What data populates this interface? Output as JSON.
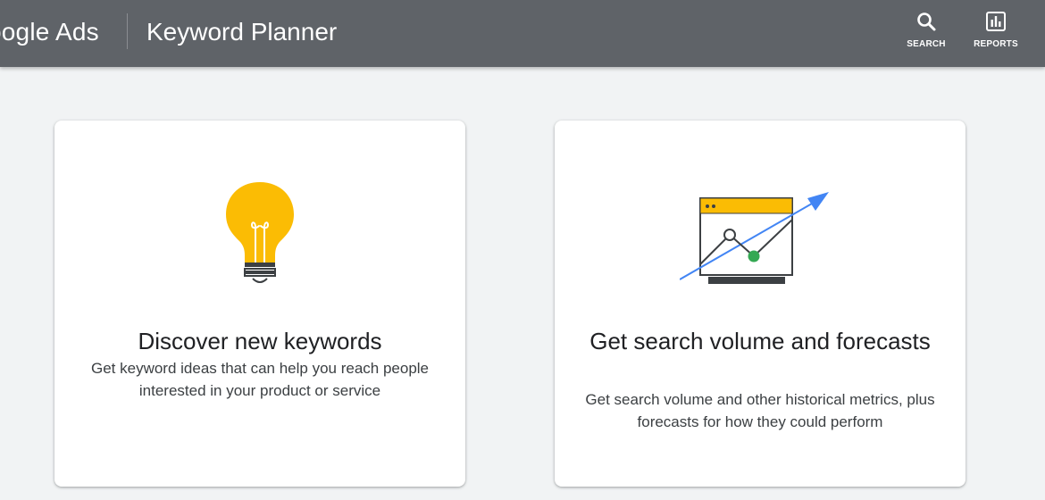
{
  "header": {
    "brand": "oogle Ads",
    "product": "Keyword Planner",
    "tools": [
      {
        "label": "SEARCH",
        "icon": "search-icon"
      },
      {
        "label": "REPORTS",
        "icon": "reports-icon"
      }
    ]
  },
  "cards": [
    {
      "title": "Discover new keywords",
      "description": "Get keyword ideas that can help you reach people interested in your product or service",
      "icon": "lightbulb-illustration"
    },
    {
      "title": "Get search volume and forecasts",
      "description": "Get search volume and other historical metrics, plus forecasts for how they could perform",
      "icon": "forecast-chart-illustration"
    }
  ],
  "colors": {
    "header_bg": "#5f6368",
    "page_bg": "#f1f3f4",
    "yellow": "#fbbc04",
    "blue": "#4285f4",
    "green": "#34a853"
  }
}
